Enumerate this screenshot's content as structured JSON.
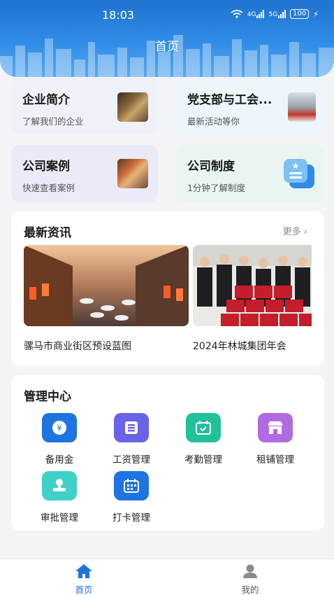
{
  "status_bar": {
    "time": "18:03",
    "net1": "4G",
    "net2": "5G",
    "battery": "100"
  },
  "header": {
    "title": "首页"
  },
  "quick_cards": [
    {
      "title": "企业简介",
      "subtitle": "了解我们的企业",
      "bg": "#eef2f8"
    },
    {
      "title": "党支部与工会...",
      "subtitle": "最新活动等你",
      "bg": "#eef6fb"
    },
    {
      "title": "公司案例",
      "subtitle": "快速查看案例",
      "bg": "#ebeaf8"
    },
    {
      "title": "公司制度",
      "subtitle": "1分钟了解制度",
      "bg": "#e8f5f0"
    }
  ],
  "news": {
    "heading": "最新资讯",
    "more_label": "更多",
    "items": [
      {
        "caption": "骡马市商业街区预设蓝图"
      },
      {
        "caption": "2024年林城集团年会"
      }
    ]
  },
  "management": {
    "heading": "管理中心",
    "tools": [
      {
        "label": "备用金",
        "icon": "petty-cash-icon",
        "color": "#1e74e0"
      },
      {
        "label": "工资管理",
        "icon": "salary-icon",
        "color": "#6a63e8"
      },
      {
        "label": "考勤管理",
        "icon": "attendance-icon",
        "color": "#20c19b"
      },
      {
        "label": "租铺管理",
        "icon": "shop-rental-icon",
        "color": "#b16ae0"
      },
      {
        "label": "审批管理",
        "icon": "approval-icon",
        "color": "#3fd0c8"
      },
      {
        "label": "打卡管理",
        "icon": "clock-in-icon",
        "color": "#1e74e0"
      }
    ]
  },
  "tabbar": {
    "tabs": [
      {
        "label": "首页",
        "icon": "home-icon",
        "active": true
      },
      {
        "label": "我的",
        "icon": "profile-icon",
        "active": false
      }
    ],
    "active_color": "#1e74e0",
    "inactive_color": "#555555"
  }
}
